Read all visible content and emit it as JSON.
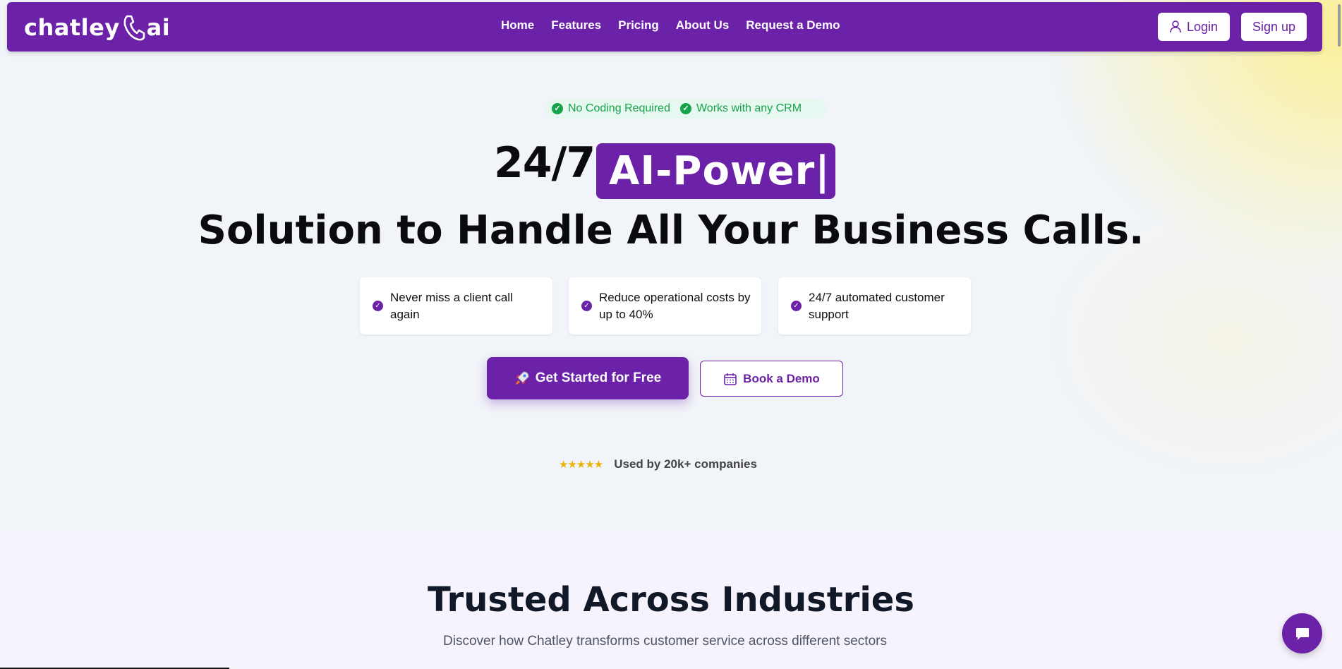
{
  "brand": {
    "logo_left": "chatley",
    "logo_right": "ai",
    "primary_color": "#6b21a8",
    "success_color": "#16a34a"
  },
  "nav": {
    "links": [
      "Home",
      "Features",
      "Pricing",
      "About Us",
      "Request a Demo"
    ],
    "login_label": "Login",
    "signup_label": "Sign up"
  },
  "hero": {
    "badges": [
      "No Coding Required",
      "Works with any CRM"
    ],
    "headline_prefix": "24/7",
    "headline_highlight": "AI-Power|",
    "headline_main": "Solution to Handle All Your Business Calls.",
    "features": [
      "Never miss a client call again",
      "Reduce operational costs by up to 40%",
      "24/7 automated customer support"
    ],
    "cta_primary": "Get Started for Free",
    "cta_secondary": "Book a Demo",
    "rating_stars": 5,
    "social_proof": "Used by 20k+ companies"
  },
  "industries": {
    "title": "Trusted Across Industries",
    "subtitle": "Discover how Chatley transforms customer service across different sectors"
  },
  "icons": {
    "login": "user-icon",
    "cta_primary": "rocket-icon",
    "cta_secondary": "calendar-icon",
    "chat": "chat-icon"
  }
}
